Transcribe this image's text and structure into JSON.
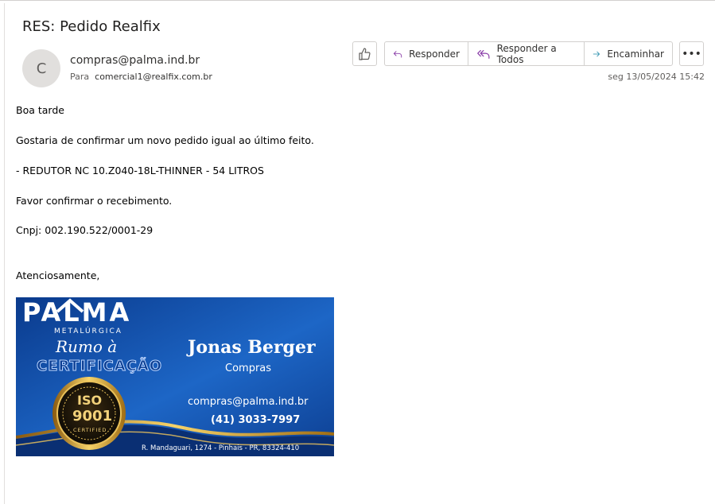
{
  "email": {
    "subject": "RES: Pedido Realfix",
    "avatar_initial": "C",
    "sender": "compras@palma.ind.br",
    "to_label": "Para",
    "to": "comercial1@realfix.com.br",
    "date": "seg 13/05/2024 15:42"
  },
  "actions": {
    "reply": "Responder",
    "reply_all": "Responder a Todos",
    "forward": "Encaminhar",
    "more": "•••"
  },
  "body": {
    "greeting": "Boa tarde",
    "line1": "Gostaria de confirmar um novo pedido igual ao último feito.",
    "line2": "- REDUTOR NC 10.Z040-18L-THINNER - 54 LITROS",
    "line3": "Favor confirmar o recebimento.",
    "line4": "Cnpj: 002.190.522/0001-29",
    "closing": "Atenciosamente,"
  },
  "signature": {
    "brand": "PALMA",
    "brand_sub": "METALÚRGICA",
    "tagline1": "Rumo à",
    "tagline2": "CERTIFICAÇÃO",
    "iso": "ISO",
    "iso_num": "9001",
    "iso_cert": "CERTIFIED",
    "name": "Jonas Berger",
    "role": "Compras",
    "email": "compras@palma.ind.br",
    "phone": "(41) 3033-7997",
    "address": "R. Mandaguari, 1274 - Pinhais - PR, 83324-410",
    "colors": {
      "bg_dark": "#0b3d91",
      "bg_light": "#1e6fd0",
      "gold": "#d4a52a"
    }
  }
}
